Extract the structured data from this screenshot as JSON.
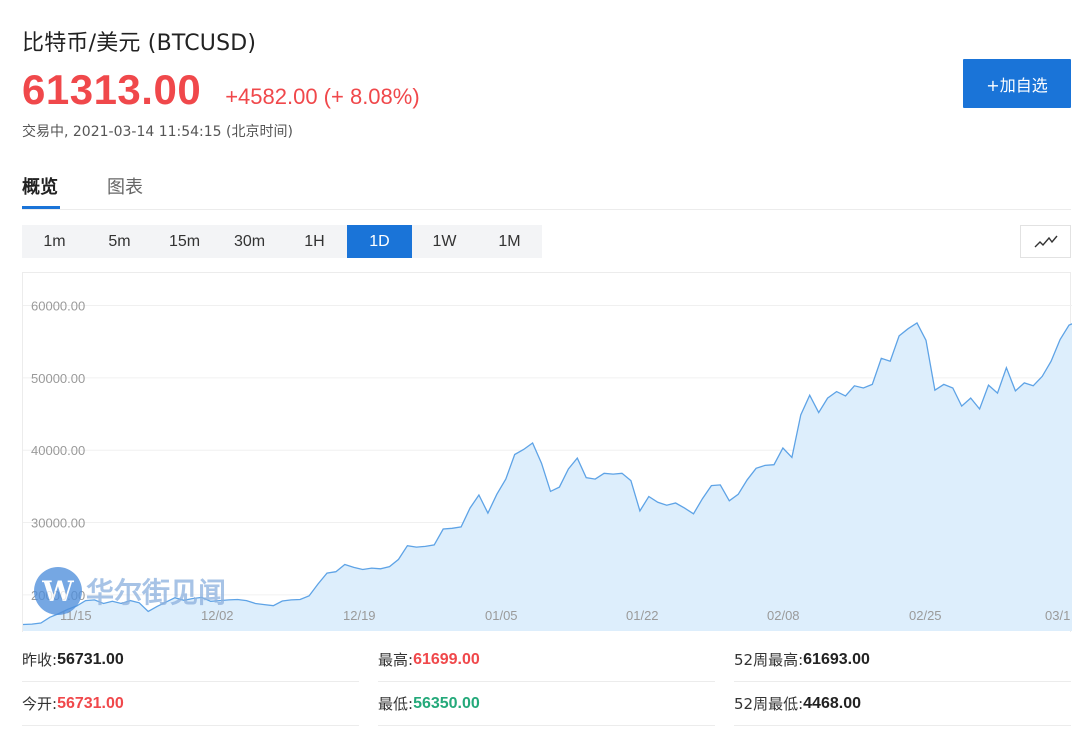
{
  "header": {
    "title": "比特币/美元 (BTCUSD)",
    "price": "61313.00",
    "change": "+4582.00 (+ 8.08%)",
    "status": "交易中, 2021-03-14 11:54:15 (北京时间)",
    "add_button": "+加自选"
  },
  "tabs": [
    "概览",
    "图表"
  ],
  "periods": [
    "1m",
    "5m",
    "15m",
    "30m",
    "1H",
    "1D",
    "1W",
    "1M"
  ],
  "active_period": "1D",
  "watermark": {
    "mark": "W",
    "text": "华尔街见闻"
  },
  "colors": {
    "up": "#f0484b",
    "down": "#24a97a",
    "accent": "#1a74d8",
    "line": "#5ea3e6",
    "fill": "#ddeefc"
  },
  "chart_data": {
    "type": "area",
    "title": "",
    "xlabel": "",
    "ylabel": "",
    "x_ticks": [
      "11/15",
      "12/02",
      "12/19",
      "01/05",
      "01/22",
      "02/08",
      "02/25",
      "03/1"
    ],
    "y_ticks": [
      "20000.00",
      "30000.00",
      "40000.00",
      "50000.00",
      "60000.00"
    ],
    "ylim": [
      15000,
      64500
    ],
    "xlim": [
      0,
      117
    ],
    "grid": true,
    "series": [
      {
        "values": [
          15900,
          15950,
          16100,
          16900,
          17400,
          18000,
          18450,
          19200,
          19300,
          18800,
          19100,
          18800,
          19200,
          18900,
          17700,
          18400,
          19000,
          19600,
          19250,
          19500,
          19650,
          19100,
          19200,
          19300,
          19350,
          19200,
          18800,
          18650,
          18500,
          19150,
          19300,
          19350,
          19850,
          21500,
          23000,
          23200,
          24200,
          23800,
          23500,
          23700,
          23600,
          23900,
          24900,
          26800,
          26600,
          26700,
          26900,
          29100,
          29200,
          29400,
          32000,
          33800,
          31300,
          33900,
          36000,
          39400,
          40100,
          41000,
          38200,
          34300,
          34900,
          37400,
          38900,
          36200,
          36000,
          36800,
          36700,
          36800,
          35800,
          31600,
          33600,
          32800,
          32400,
          32700,
          32000,
          31200,
          33300,
          35100,
          35200,
          33000,
          33900,
          35900,
          37500,
          37900,
          38000,
          40300,
          39000,
          44900,
          47600,
          45200,
          47200,
          48100,
          47500,
          48900,
          48600,
          49100,
          52700,
          52300,
          55800,
          56800,
          57600,
          55200,
          48300,
          49100,
          48600,
          46100,
          47200,
          45700,
          49000,
          47900,
          51400,
          48200,
          49300,
          48900,
          50200,
          52300,
          55300,
          57300,
          57800,
          57500,
          61300,
          61313
        ]
      }
    ]
  },
  "stats": {
    "prev_close": {
      "label": "昨收:",
      "value": "56731.00"
    },
    "open": {
      "label": "今开:",
      "value": "56731.00"
    },
    "high": {
      "label": "最高:",
      "value": "61699.00"
    },
    "low": {
      "label": "最低:",
      "value": "56350.00"
    },
    "week52_high": {
      "label": "52周最高:",
      "value": "61693.00"
    },
    "week52_low": {
      "label": "52周最低:",
      "value": "4468.00"
    }
  }
}
